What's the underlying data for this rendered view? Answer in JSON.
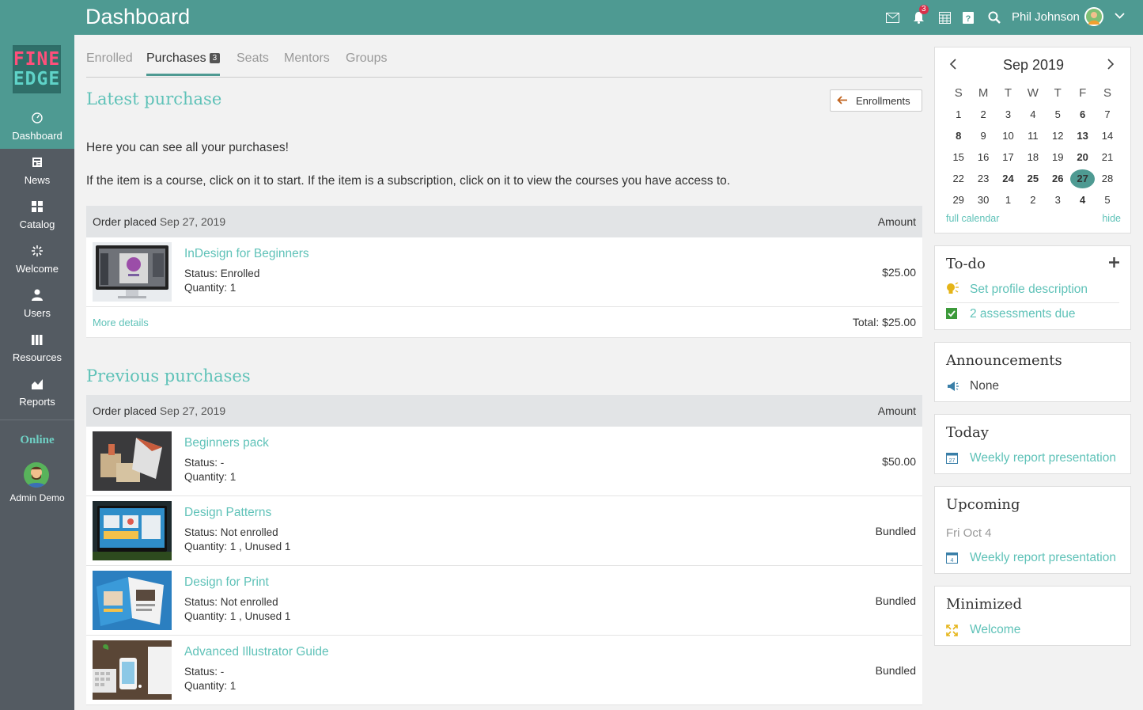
{
  "header": {
    "title": "Dashboard",
    "notifications_count": "3",
    "user_name": "Phil Johnson",
    "icons": [
      "mail-icon",
      "bell-icon",
      "calendar-icon",
      "help-icon",
      "search-icon",
      "chevron-down-icon"
    ]
  },
  "logo": {
    "line1": "FINE",
    "line2": "EDGE"
  },
  "sidebar": {
    "items": [
      {
        "label": "Dashboard",
        "icon": "dashboard-icon",
        "active": true
      },
      {
        "label": "News",
        "icon": "news-icon"
      },
      {
        "label": "Catalog",
        "icon": "catalog-icon"
      },
      {
        "label": "Welcome",
        "icon": "welcome-icon"
      },
      {
        "label": "Users",
        "icon": "users-icon"
      },
      {
        "label": "Resources",
        "icon": "resources-icon"
      },
      {
        "label": "Reports",
        "icon": "reports-icon"
      }
    ],
    "online_label": "Online",
    "online_user": "Admin Demo"
  },
  "tabs": [
    {
      "label": "Enrolled"
    },
    {
      "label": "Purchases",
      "badge": "3",
      "active": true
    },
    {
      "label": "Seats"
    },
    {
      "label": "Mentors"
    },
    {
      "label": "Groups"
    }
  ],
  "latest": {
    "heading": "Latest purchase",
    "enrollments_button": "Enrollments",
    "intro1": "Here you can see all your purchases!",
    "intro2": "If the item is a course, click on it to start. If the item is a subscription, click on it to view the courses you have access to.",
    "order_label": "Order placed",
    "order_date": "Sep 27, 2019",
    "amount_label": "Amount",
    "item": {
      "title": "InDesign for Beginners",
      "status_label": "Status:",
      "status": "Enrolled",
      "qty_label": "Quantity:",
      "qty": "1",
      "amount": "$25.00"
    },
    "more_details": "More details",
    "total_label": "Total:",
    "total": "$25.00"
  },
  "previous": {
    "heading": "Previous purchases",
    "order_label": "Order placed",
    "order_date": "Sep 27, 2019",
    "amount_label": "Amount",
    "items": [
      {
        "title": "Beginners pack",
        "status_label": "Status:",
        "status": "-",
        "qty_label": "Quantity:",
        "qty": "1",
        "amount": "$50.00"
      },
      {
        "title": "Design Patterns",
        "status_label": "Status:",
        "status": "Not enrolled",
        "qty_label": "Quantity:",
        "qty": "1 , Unused 1",
        "amount": "Bundled"
      },
      {
        "title": "Design for Print",
        "status_label": "Status:",
        "status": "Not enrolled",
        "qty_label": "Quantity:",
        "qty": "1 , Unused 1",
        "amount": "Bundled"
      },
      {
        "title": "Advanced Illustrator Guide",
        "status_label": "Status:",
        "status": "-",
        "qty_label": "Quantity:",
        "qty": "1",
        "amount": "Bundled"
      }
    ]
  },
  "calendar": {
    "month": "Sep 2019",
    "weekdays": [
      "S",
      "M",
      "T",
      "W",
      "T",
      "F",
      "S"
    ],
    "weeks": [
      [
        "1",
        "2",
        "3",
        "4",
        "5",
        "6",
        "7"
      ],
      [
        "8",
        "9",
        "10",
        "11",
        "12",
        "13",
        "14"
      ],
      [
        "15",
        "16",
        "17",
        "18",
        "19",
        "20",
        "21"
      ],
      [
        "22",
        "23",
        "24",
        "25",
        "26",
        "27",
        "28"
      ],
      [
        "29",
        "30",
        "1",
        "2",
        "3",
        "4",
        "5"
      ]
    ],
    "bold_days": [
      "6",
      "8",
      "13",
      "20",
      "24",
      "25",
      "26",
      "4"
    ],
    "today": "27",
    "full_calendar": "full calendar",
    "hide": "hide"
  },
  "todo": {
    "title": "To-do",
    "items": [
      {
        "label": "Set profile description",
        "icon": "lightbulb-icon"
      },
      {
        "label": "2 assessments due",
        "icon": "checkbox-icon"
      }
    ]
  },
  "announcements": {
    "title": "Announcements",
    "value": "None"
  },
  "today_card": {
    "title": "Today",
    "event": "Weekly report presentation",
    "day_icon_text": "27"
  },
  "upcoming": {
    "title": "Upcoming",
    "date": "Fri Oct 4",
    "event": "Weekly report presentation",
    "day_icon_text": "4"
  },
  "minimized": {
    "title": "Minimized",
    "item": "Welcome"
  }
}
